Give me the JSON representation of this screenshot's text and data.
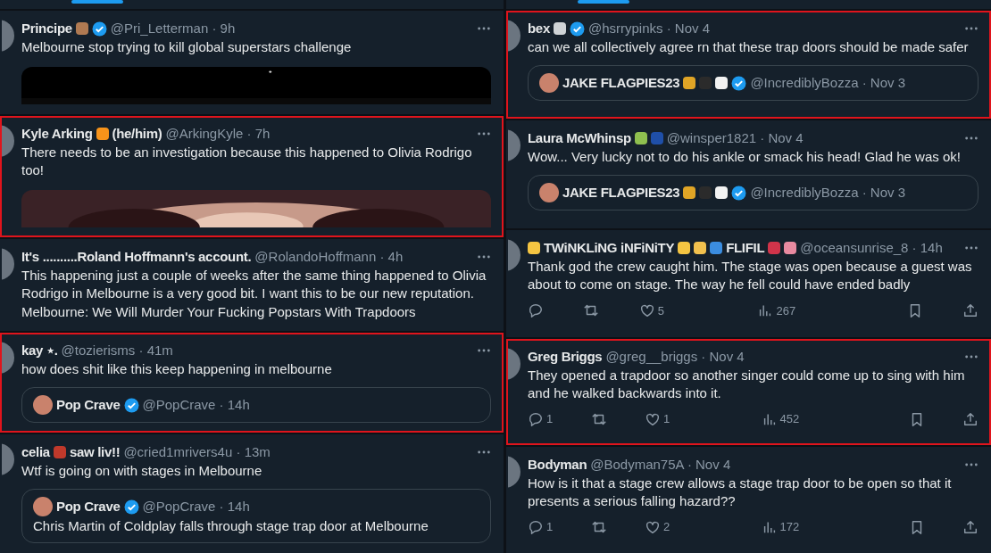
{
  "columns": [
    {
      "tweets": [
        {
          "name_parts": [
            {
              "kind": "text",
              "text": "Principe"
            },
            {
              "kind": "emoji",
              "color": "#b07a52"
            }
          ],
          "verified": true,
          "meta": "@Pri_Letterman · 9h",
          "text": [
            "Melbourne stop trying to kill global superstars challenge"
          ],
          "highlighted": false,
          "media": {
            "kind": "picture"
          }
        },
        {
          "name_parts": [
            {
              "kind": "text",
              "text": "Kyle Arking"
            },
            {
              "kind": "emoji",
              "color": "#f7931a"
            },
            {
              "kind": "text",
              "text": "(he/him)"
            }
          ],
          "verified": false,
          "meta": "@ArkingKyle · 7h",
          "text": [
            "There needs to be an investigation because this happened to Olivia Rodrigo too!"
          ],
          "highlighted": true,
          "media": {
            "kind": "picture"
          }
        },
        {
          "name_parts": [
            {
              "kind": "text",
              "text": "It's ..........Roland Hoffmann's account."
            }
          ],
          "verified": false,
          "meta": "@RolandoHoffmann · 4h",
          "text": [
            "This happening just a couple of weeks after the same thing happened to Olivia Rodrigo in Melbourne is a very good bit. I want this to be our new reputation.",
            "Melbourne: We Will Murder Your Fucking Popstars With Trapdoors"
          ],
          "highlighted": false
        },
        {
          "name_parts": [
            {
              "kind": "text",
              "text": "kay ⋆."
            }
          ],
          "verified": false,
          "meta": "@tozierisms · 41m",
          "text": [
            "how does shit like this keep happening in melbourne"
          ],
          "highlighted": true,
          "quote": {
            "name": "Pop Crave",
            "verified": true,
            "meta": "@PopCrave · 14h"
          }
        },
        {
          "name_parts": [
            {
              "kind": "text",
              "text": "celia"
            },
            {
              "kind": "emoji",
              "color": "#c0392b"
            },
            {
              "kind": "text",
              "text": "saw liv!!"
            }
          ],
          "verified": false,
          "meta": "@cried1mrivers4u · 13m",
          "text": [
            "Wtf is going on with stages in Melbourne"
          ],
          "highlighted": false,
          "quote": {
            "name": "Pop Crave",
            "verified": true,
            "meta": "@PopCrave · 14h",
            "text": "Chris Martin of Coldplay falls through stage trap door at Melbourne"
          }
        }
      ]
    },
    {
      "tweets": [
        {
          "name_parts": [
            {
              "kind": "text",
              "text": "bex"
            },
            {
              "kind": "emoji",
              "color": "#cfd3d6"
            }
          ],
          "verified": true,
          "meta": "@hsrrypinks · Nov 4",
          "text": [
            "can we all collectively agree rn that these trap doors should be made safer"
          ],
          "highlighted": true,
          "quote": {
            "name": "JAKE FLAGPIES23",
            "emojis": [
              {
                "color": "#e0a526"
              },
              {
                "color": "#2b2b2b"
              },
              {
                "color": "#f2f2f2"
              }
            ],
            "verified": true,
            "meta": "@IncrediblyBozza · Nov 3"
          }
        },
        {
          "name_parts": [
            {
              "kind": "text",
              "text": "Laura McWhinsp"
            },
            {
              "kind": "emoji",
              "color": "#8fbf4f"
            },
            {
              "kind": "emoji",
              "color": "#1f4fa8"
            }
          ],
          "verified": false,
          "meta": "@winsper1821 · Nov 4",
          "text": [
            "Wow... Very lucky not to do his ankle or smack his head! Glad he was ok!"
          ],
          "highlighted": false,
          "quote": {
            "name": "JAKE FLAGPIES23",
            "emojis": [
              {
                "color": "#e0a526"
              },
              {
                "color": "#2b2b2b"
              },
              {
                "color": "#f2f2f2"
              }
            ],
            "verified": true,
            "meta": "@IncrediblyBozza · Nov 3"
          }
        },
        {
          "name_parts": [
            {
              "kind": "emoji",
              "color": "#f5c542"
            },
            {
              "kind": "text",
              "text": "TWiNKLiNG iNFiNiTY"
            },
            {
              "kind": "emoji",
              "color": "#f5c542"
            },
            {
              "kind": "emoji",
              "color": "#f2c14e"
            },
            {
              "kind": "emoji",
              "color": "#3b8de0"
            },
            {
              "kind": "text",
              "text": "FLIFIL"
            },
            {
              "kind": "emoji",
              "color": "#d1344a"
            },
            {
              "kind": "emoji",
              "color": "#e88aa0"
            }
          ],
          "verified": false,
          "meta": "@oceansunrise_8 · 14h",
          "text": [
            "Thank god the crew caught him. The stage was open because a guest was about to come on stage. The way he fell could have ended badly"
          ],
          "highlighted": false,
          "actions": [
            {
              "kind": "reply"
            },
            {
              "kind": "retweet"
            },
            {
              "kind": "like",
              "count": "5"
            },
            {
              "kind": "views",
              "count": "267"
            },
            {
              "kind": "bookmark"
            },
            {
              "kind": "share"
            }
          ]
        },
        {
          "name_parts": [
            {
              "kind": "text",
              "text": "Greg Briggs"
            }
          ],
          "verified": false,
          "meta": "@greg__briggs · Nov 4",
          "text": [
            "They opened a trapdoor so another singer could come up to sing with him and he walked backwards into it."
          ],
          "highlighted": true,
          "actions": [
            {
              "kind": "reply",
              "count": "1"
            },
            {
              "kind": "retweet"
            },
            {
              "kind": "like",
              "count": "1"
            },
            {
              "kind": "views",
              "count": "452"
            },
            {
              "kind": "bookmark"
            },
            {
              "kind": "share"
            }
          ]
        },
        {
          "name_parts": [
            {
              "kind": "text",
              "text": "Bodyman"
            }
          ],
          "verified": false,
          "meta": "@Bodyman75A · Nov 4",
          "text": [
            "How is it that a stage crew  allows a stage trap door to be open so that it presents a serious falling hazard??"
          ],
          "highlighted": false,
          "actions": [
            {
              "kind": "reply",
              "count": "1"
            },
            {
              "kind": "retweet"
            },
            {
              "kind": "like",
              "count": "2"
            },
            {
              "kind": "views",
              "count": "172"
            },
            {
              "kind": "bookmark"
            },
            {
              "kind": "share"
            }
          ]
        }
      ]
    }
  ]
}
